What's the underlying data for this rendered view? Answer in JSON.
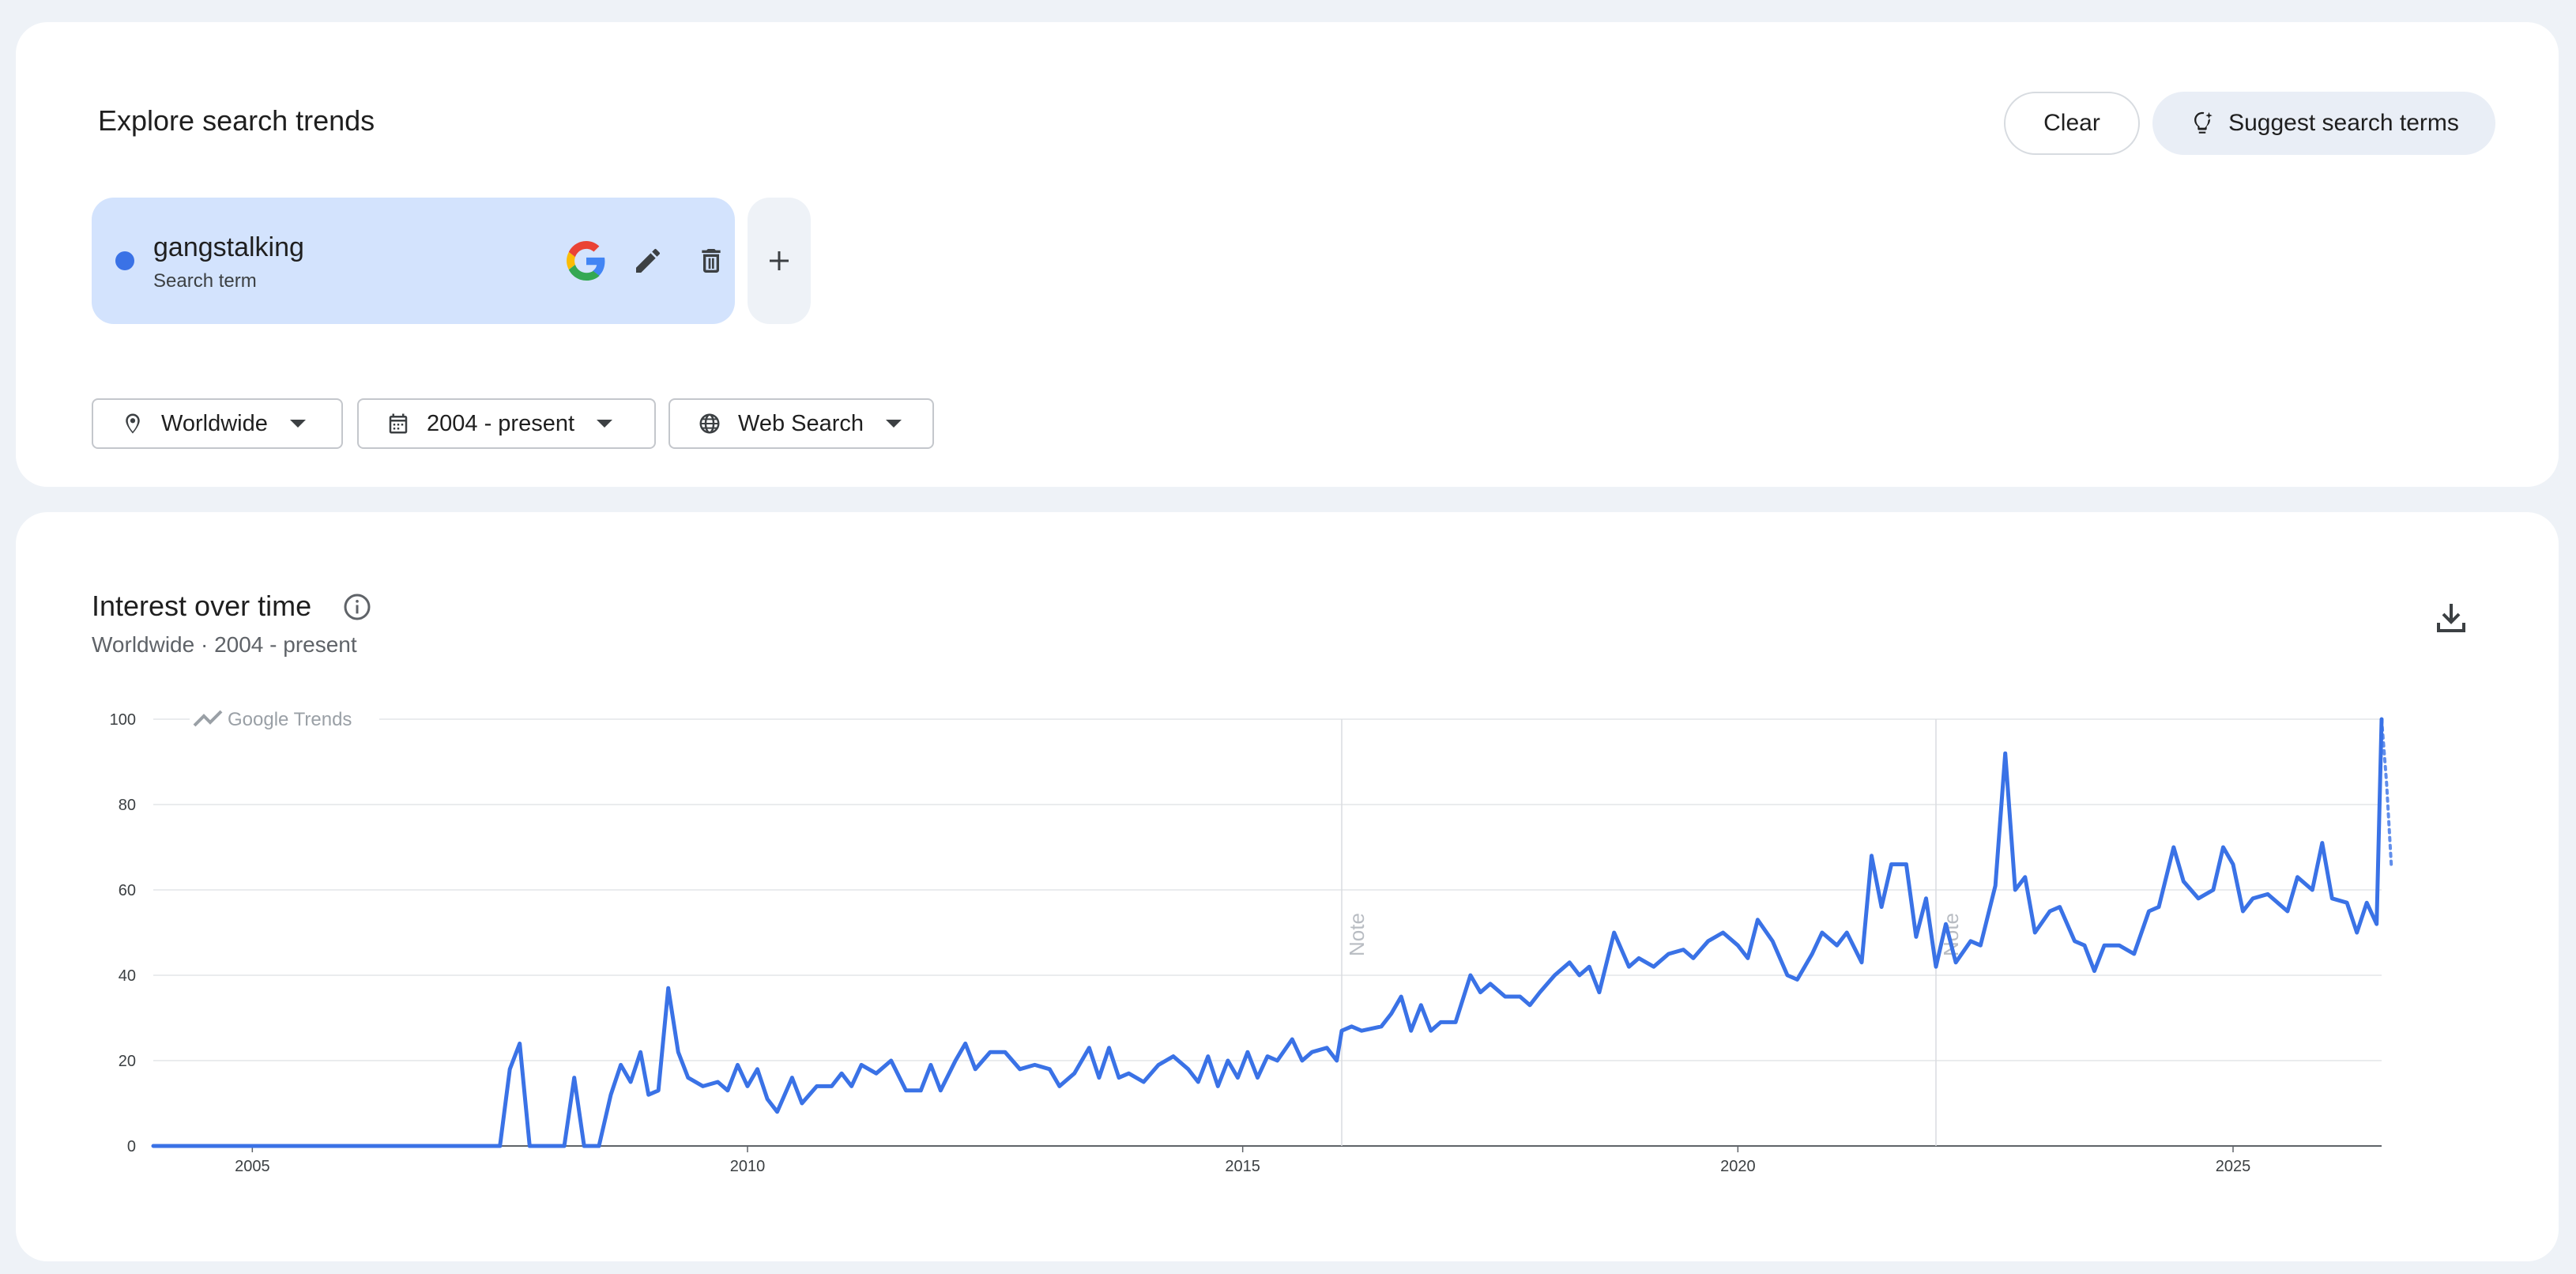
{
  "explore": {
    "title": "Explore search trends",
    "clear_label": "Clear",
    "suggest_label": "Suggest search terms"
  },
  "term": {
    "name": "gangstalking",
    "type": "Search term",
    "color": "#3a72e6"
  },
  "filters": {
    "location": "Worldwide",
    "time": "2004 - present",
    "property": "Web Search"
  },
  "interest": {
    "title": "Interest over time",
    "subtitle": "Worldwide · 2004 - present"
  },
  "icons": {
    "chip": [
      "google-icon",
      "pencil-icon",
      "trash-icon"
    ],
    "add": "plus-icon",
    "filters": [
      "location-pin-icon",
      "calendar-icon",
      "globe-icon"
    ],
    "info": "info-icon",
    "download": "download-icon",
    "suggest": "lightbulb-sparkle-icon"
  },
  "chart_data": {
    "type": "line",
    "title": "",
    "xlabel": "",
    "ylabel": "",
    "ylim": [
      0,
      100
    ],
    "xlim": [
      2004.0,
      2026.5
    ],
    "yticks": [
      "0",
      "20",
      "40",
      "60",
      "80",
      "100"
    ],
    "xticks": [
      {
        "x": 2005,
        "label": "2005"
      },
      {
        "x": 2010,
        "label": "2010"
      },
      {
        "x": 2015,
        "label": "2015"
      },
      {
        "x": 2020,
        "label": "2020"
      },
      {
        "x": 2025,
        "label": "2025"
      }
    ],
    "grid": true,
    "watermark": "Google Trends",
    "notes": [
      {
        "x": 2016.0,
        "label": "Note"
      },
      {
        "x": 2022.0,
        "label": "Note"
      }
    ],
    "series": [
      {
        "color": "#3a72e6",
        "points": [
          [
            2004.0,
            0
          ],
          [
            2007.5,
            0
          ],
          [
            2007.6,
            18
          ],
          [
            2007.7,
            24
          ],
          [
            2007.8,
            0
          ],
          [
            2008.15,
            0
          ],
          [
            2008.25,
            16
          ],
          [
            2008.35,
            0
          ],
          [
            2008.5,
            0
          ],
          [
            2008.62,
            12
          ],
          [
            2008.72,
            19
          ],
          [
            2008.82,
            15
          ],
          [
            2008.92,
            22
          ],
          [
            2009.0,
            12
          ],
          [
            2009.1,
            13
          ],
          [
            2009.2,
            37
          ],
          [
            2009.3,
            22
          ],
          [
            2009.4,
            16
          ],
          [
            2009.55,
            14
          ],
          [
            2009.7,
            15
          ],
          [
            2009.8,
            13
          ],
          [
            2009.9,
            19
          ],
          [
            2010.0,
            14
          ],
          [
            2010.1,
            18
          ],
          [
            2010.2,
            11
          ],
          [
            2010.3,
            8
          ],
          [
            2010.45,
            16
          ],
          [
            2010.55,
            10
          ],
          [
            2010.7,
            14
          ],
          [
            2010.85,
            14
          ],
          [
            2010.95,
            17
          ],
          [
            2011.05,
            14
          ],
          [
            2011.15,
            19
          ],
          [
            2011.3,
            17
          ],
          [
            2011.45,
            20
          ],
          [
            2011.6,
            13
          ],
          [
            2011.75,
            13
          ],
          [
            2011.85,
            19
          ],
          [
            2011.95,
            13
          ],
          [
            2012.1,
            20
          ],
          [
            2012.2,
            24
          ],
          [
            2012.3,
            18
          ],
          [
            2012.45,
            22
          ],
          [
            2012.6,
            22
          ],
          [
            2012.75,
            18
          ],
          [
            2012.9,
            19
          ],
          [
            2013.05,
            18
          ],
          [
            2013.15,
            14
          ],
          [
            2013.3,
            17
          ],
          [
            2013.45,
            23
          ],
          [
            2013.55,
            16
          ],
          [
            2013.65,
            23
          ],
          [
            2013.75,
            16
          ],
          [
            2013.85,
            17
          ],
          [
            2014.0,
            15
          ],
          [
            2014.15,
            19
          ],
          [
            2014.3,
            21
          ],
          [
            2014.45,
            18
          ],
          [
            2014.55,
            15
          ],
          [
            2014.65,
            21
          ],
          [
            2014.75,
            14
          ],
          [
            2014.85,
            20
          ],
          [
            2014.95,
            16
          ],
          [
            2015.05,
            22
          ],
          [
            2015.15,
            16
          ],
          [
            2015.25,
            21
          ],
          [
            2015.35,
            20
          ],
          [
            2015.5,
            25
          ],
          [
            2015.6,
            20
          ],
          [
            2015.7,
            22
          ],
          [
            2015.85,
            23
          ],
          [
            2015.95,
            20
          ],
          [
            2016.0,
            27
          ],
          [
            2016.1,
            28
          ],
          [
            2016.2,
            27
          ],
          [
            2016.4,
            28
          ],
          [
            2016.5,
            31
          ],
          [
            2016.6,
            35
          ],
          [
            2016.7,
            27
          ],
          [
            2016.8,
            33
          ],
          [
            2016.9,
            27
          ],
          [
            2017.0,
            29
          ],
          [
            2017.15,
            29
          ],
          [
            2017.3,
            40
          ],
          [
            2017.4,
            36
          ],
          [
            2017.5,
            38
          ],
          [
            2017.65,
            35
          ],
          [
            2017.8,
            35
          ],
          [
            2017.9,
            33
          ],
          [
            2018.0,
            36
          ],
          [
            2018.15,
            40
          ],
          [
            2018.3,
            43
          ],
          [
            2018.4,
            40
          ],
          [
            2018.5,
            42
          ],
          [
            2018.6,
            36
          ],
          [
            2018.75,
            50
          ],
          [
            2018.9,
            42
          ],
          [
            2019.0,
            44
          ],
          [
            2019.15,
            42
          ],
          [
            2019.3,
            45
          ],
          [
            2019.45,
            46
          ],
          [
            2019.55,
            44
          ],
          [
            2019.7,
            48
          ],
          [
            2019.85,
            50
          ],
          [
            2020.0,
            47
          ],
          [
            2020.1,
            44
          ],
          [
            2020.2,
            53
          ],
          [
            2020.35,
            48
          ],
          [
            2020.5,
            40
          ],
          [
            2020.6,
            39
          ],
          [
            2020.75,
            45
          ],
          [
            2020.85,
            50
          ],
          [
            2021.0,
            47
          ],
          [
            2021.1,
            50
          ],
          [
            2021.25,
            43
          ],
          [
            2021.35,
            68
          ],
          [
            2021.45,
            56
          ],
          [
            2021.55,
            66
          ],
          [
            2021.7,
            66
          ],
          [
            2021.8,
            49
          ],
          [
            2021.9,
            58
          ],
          [
            2022.0,
            42
          ],
          [
            2022.1,
            52
          ],
          [
            2022.2,
            43
          ],
          [
            2022.35,
            48
          ],
          [
            2022.45,
            47
          ],
          [
            2022.6,
            61
          ],
          [
            2022.7,
            92
          ],
          [
            2022.8,
            60
          ],
          [
            2022.9,
            63
          ],
          [
            2023.0,
            50
          ],
          [
            2023.15,
            55
          ],
          [
            2023.25,
            56
          ],
          [
            2023.4,
            48
          ],
          [
            2023.5,
            47
          ],
          [
            2023.6,
            41
          ],
          [
            2023.7,
            47
          ],
          [
            2023.85,
            47
          ],
          [
            2024.0,
            45
          ],
          [
            2024.15,
            55
          ],
          [
            2024.25,
            56
          ],
          [
            2024.4,
            70
          ],
          [
            2024.5,
            62
          ],
          [
            2024.65,
            58
          ],
          [
            2024.8,
            60
          ],
          [
            2024.9,
            70
          ],
          [
            2025.0,
            66
          ],
          [
            2025.1,
            55
          ],
          [
            2025.2,
            58
          ],
          [
            2025.35,
            59
          ],
          [
            2025.45,
            57
          ],
          [
            2025.55,
            55
          ],
          [
            2025.65,
            63
          ],
          [
            2025.8,
            60
          ],
          [
            2025.9,
            71
          ],
          [
            2026.0,
            58
          ],
          [
            2026.15,
            57
          ],
          [
            2026.25,
            50
          ],
          [
            2026.35,
            57
          ],
          [
            2026.45,
            52
          ],
          [
            2026.5,
            100
          ]
        ],
        "partial_points": [
          [
            2026.5,
            100
          ],
          [
            2026.55,
            85
          ],
          [
            2026.6,
            65
          ]
        ]
      }
    ]
  }
}
